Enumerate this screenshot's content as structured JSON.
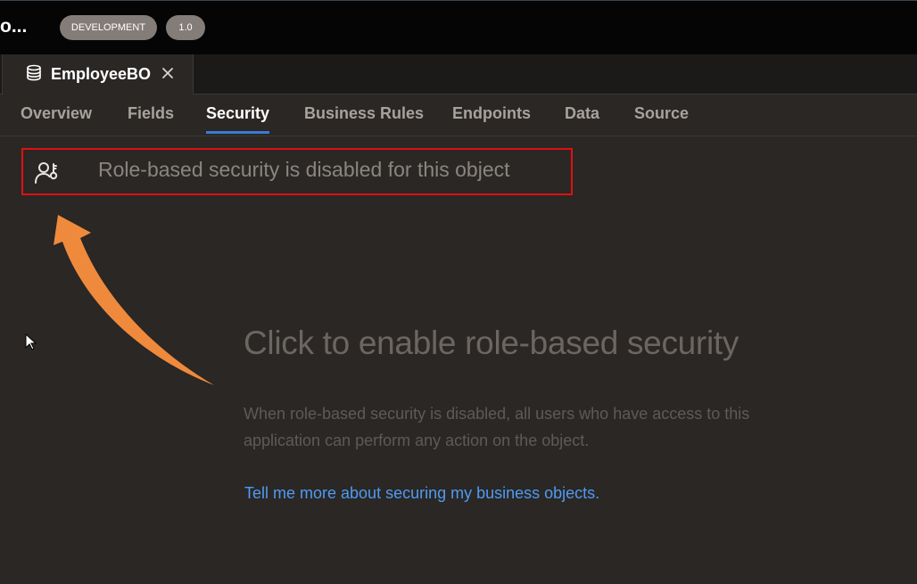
{
  "header": {
    "app_title": "o...",
    "environment_badge": "DEVELOPMENT",
    "version_badge": "1.0"
  },
  "editor": {
    "file_tab": {
      "label": "EmployeeBO",
      "close_glyph": "×",
      "icon": "database-icon"
    },
    "tabs": [
      {
        "label": "Overview",
        "active": false
      },
      {
        "label": "Fields",
        "active": false
      },
      {
        "label": "Security",
        "active": true
      },
      {
        "label": "Business Rules",
        "active": false
      },
      {
        "label": "Endpoints",
        "active": false
      },
      {
        "label": "Data",
        "active": false
      },
      {
        "label": "Source",
        "active": false
      }
    ]
  },
  "security": {
    "banner_text": "Role-based security is disabled for this object",
    "banner_icon": "user-key-icon",
    "headline": "Click to enable role-based security",
    "description": "When role-based security is disabled, all users who have access to this application can perform any action on the object.",
    "learn_more_link": "Tell me more about securing my business objects."
  },
  "colors": {
    "background": "#2a2725",
    "topbar": "#050505",
    "accent_tab_underline": "#3a7bd5",
    "highlight_box": "#e01010",
    "arrow": "#ef8a3c",
    "link": "#4f9bf2"
  }
}
